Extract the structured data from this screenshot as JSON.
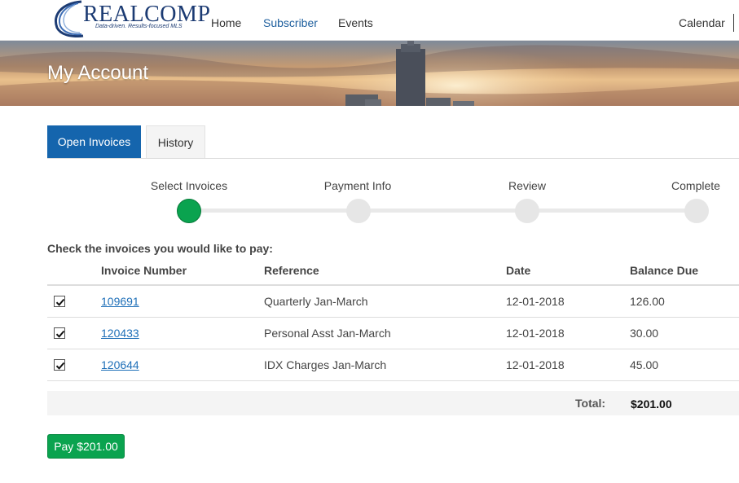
{
  "brand": {
    "name": "REALCOMP",
    "tagline": "Data-driven. Results-focused MLS"
  },
  "nav": {
    "items": [
      "Home",
      "Subscriber",
      "Events",
      "Calendar"
    ],
    "active": "Subscriber"
  },
  "banner": {
    "title": "My Account"
  },
  "tabs": {
    "open_invoices": "Open Invoices",
    "history": "History",
    "active": "Open Invoices"
  },
  "stepper": {
    "steps": [
      "Select Invoices",
      "Payment Info",
      "Review",
      "Complete"
    ],
    "current_step": 1
  },
  "invoices": {
    "instructions": "Check the invoices you would like to pay:",
    "headers": [
      "Invoice Number",
      "Reference",
      "Date",
      "Balance Due"
    ],
    "rows": [
      {
        "checked": true,
        "number": "109691",
        "reference": "Quarterly Jan-March",
        "date": "12-01-2018",
        "balance": "126.00"
      },
      {
        "checked": true,
        "number": "120433",
        "reference": "Personal Asst Jan-March",
        "date": "12-01-2018",
        "balance": "30.00"
      },
      {
        "checked": true,
        "number": "120644",
        "reference": "IDX Charges Jan-March",
        "date": "12-01-2018",
        "balance": "45.00"
      }
    ],
    "total_label": "Total:",
    "total_value": "$201.00"
  },
  "pay_button": {
    "label": "Pay $201.00"
  },
  "colors": {
    "primary_blue": "#1565ad",
    "success_green": "#0aa34f",
    "link_blue": "#1e6fb8",
    "brand_navy": "#1c3b73"
  }
}
